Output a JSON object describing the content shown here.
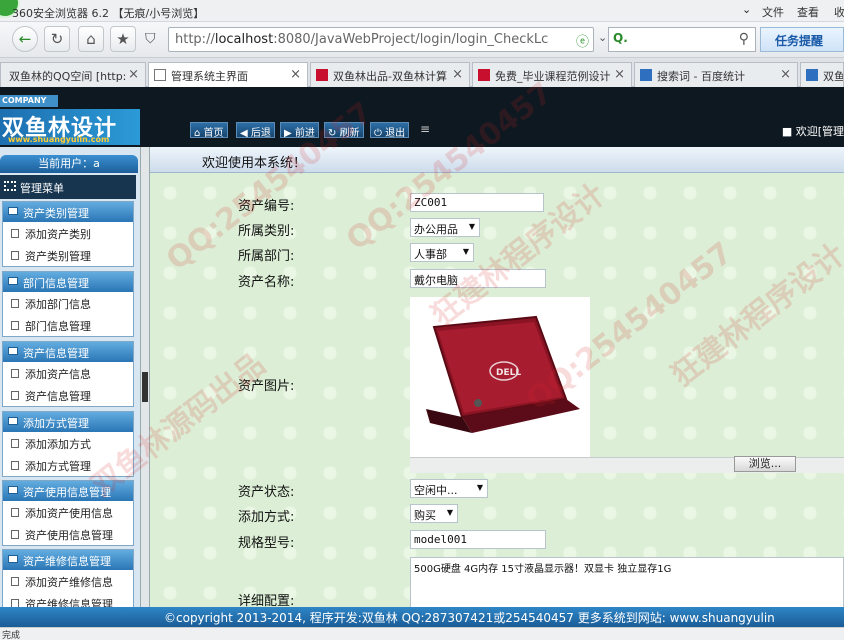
{
  "browser": {
    "title": "360安全浏览器 6.2 【无痕/小号浏览】",
    "menu": [
      "文件",
      "查看",
      "收"
    ],
    "address": {
      "pre": "http://",
      "host": "localhost",
      "rest": ":8080/JavaWebProject/login/login_CheckLc"
    },
    "remind": "任务提醒",
    "tabs": [
      {
        "label": "双鱼林的QQ空间 [http:"
      },
      {
        "label": "管理系统主界面"
      },
      {
        "label": "双鱼林出品-双鱼林计算"
      },
      {
        "label": "免费_毕业课程范例设计"
      },
      {
        "label": "搜索词 - 百度统计"
      },
      {
        "label": "双鱼"
      }
    ],
    "status": "完成"
  },
  "header": {
    "company": "COMPANY",
    "logo": "双鱼林设计",
    "logo_url": "www.shuangyulin.com",
    "nav": [
      "首页",
      "后退",
      "前进",
      "刷新",
      "退出"
    ],
    "welcome": "欢迎[管理"
  },
  "sidebar": {
    "current_user": "当前用户：a",
    "menu_title": "管理菜单",
    "groups": [
      {
        "title": "资产类别管理",
        "items": [
          "添加资产类别",
          "资产类别管理"
        ]
      },
      {
        "title": "部门信息管理",
        "items": [
          "添加部门信息",
          "部门信息管理"
        ]
      },
      {
        "title": "资产信息管理",
        "items": [
          "添加资产信息",
          "资产信息管理"
        ]
      },
      {
        "title": "添加方式管理",
        "items": [
          "添加添加方式",
          "添加方式管理"
        ]
      },
      {
        "title": "资产使用信息管理",
        "items": [
          "添加资产使用信息",
          "资产使用信息管理"
        ]
      },
      {
        "title": "资产维修信息管理",
        "items": [
          "添加资产维修信息",
          "资产维修信息管理"
        ]
      }
    ]
  },
  "main": {
    "title": "欢迎使用本系统！",
    "labels": {
      "asset_no": "资产编号:",
      "category": "所属类别:",
      "dept": "所属部门:",
      "name": "资产名称:",
      "image": "资产图片:",
      "state": "资产状态:",
      "method": "添加方式:",
      "model": "规格型号:",
      "detail": "详细配置:"
    },
    "values": {
      "asset_no": "ZC001",
      "category": "办公用品",
      "dept": "人事部",
      "name": "戴尔电脑",
      "state": "空闲中...",
      "method": "购买",
      "model": "model001",
      "detail": "500G硬盘 4G内存 15寸液晶显示器！双显卡 独立显存1G"
    },
    "browse": "浏览...",
    "laptop_brand": "DELL"
  },
  "footer": "©copyright 2013-2014, 程序开发:双鱼林  QQ:287307421或254540457  更多系统到网站: www.shuangyulin",
  "watermarks": [
    "QQ:254540457",
    "双鱼林源码出品",
    "狂建林程序设计"
  ],
  "colors": {
    "accent": "#1a5c97",
    "page_bg": "#dcefd6",
    "header_bg": "#0d1820"
  }
}
